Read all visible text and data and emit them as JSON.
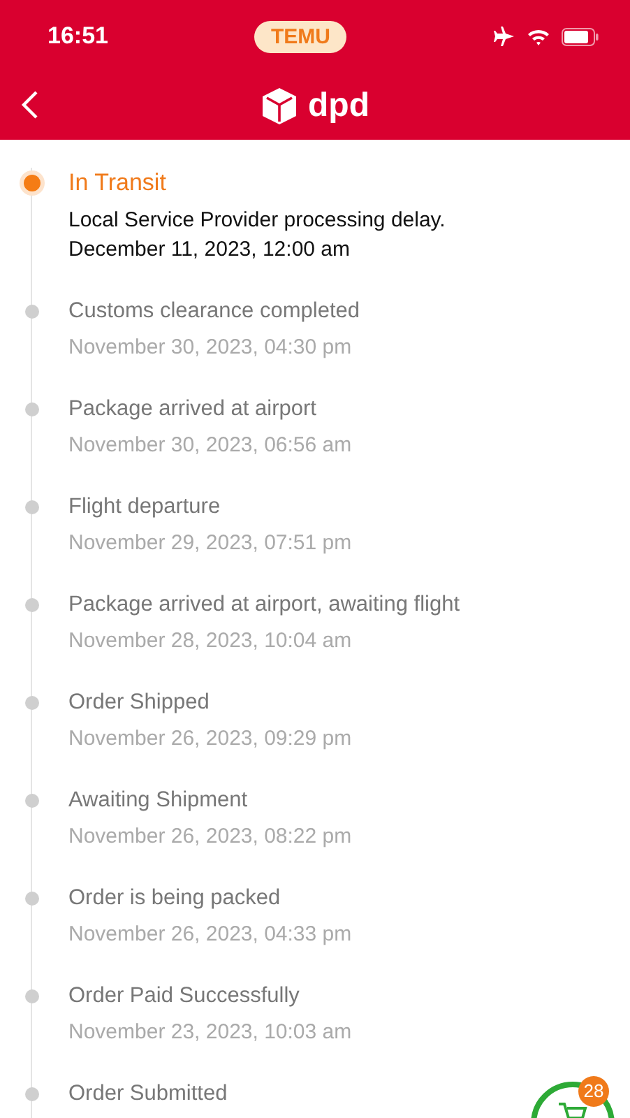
{
  "status_bar": {
    "time": "16:51",
    "app_badge": "TEMU"
  },
  "nav": {
    "brand": "dpd"
  },
  "events": [
    {
      "title": "In Transit",
      "current": true,
      "description": "Local Service Provider processing delay.",
      "date": "December 11, 2023, 12:00 am"
    },
    {
      "title": "Customs clearance completed",
      "current": false,
      "date": "November 30, 2023, 04:30 pm"
    },
    {
      "title": "Package arrived at airport",
      "current": false,
      "date": "November 30, 2023, 06:56 am"
    },
    {
      "title": "Flight departure",
      "current": false,
      "date": "November 29, 2023, 07:51 pm"
    },
    {
      "title": "Package arrived at airport, awaiting flight",
      "current": false,
      "date": "November 28, 2023, 10:04 am"
    },
    {
      "title": "Order Shipped",
      "current": false,
      "date": "November 26, 2023, 09:29 pm"
    },
    {
      "title": "Awaiting Shipment",
      "current": false,
      "date": "November 26, 2023, 08:22 pm"
    },
    {
      "title": "Order is being packed",
      "current": false,
      "date": "November 26, 2023, 04:33 pm"
    },
    {
      "title": "Order Paid Successfully",
      "current": false,
      "date": "November 23, 2023, 10:03 am"
    },
    {
      "title": "Order Submitted",
      "current": false
    }
  ],
  "cart": {
    "count": "28"
  }
}
